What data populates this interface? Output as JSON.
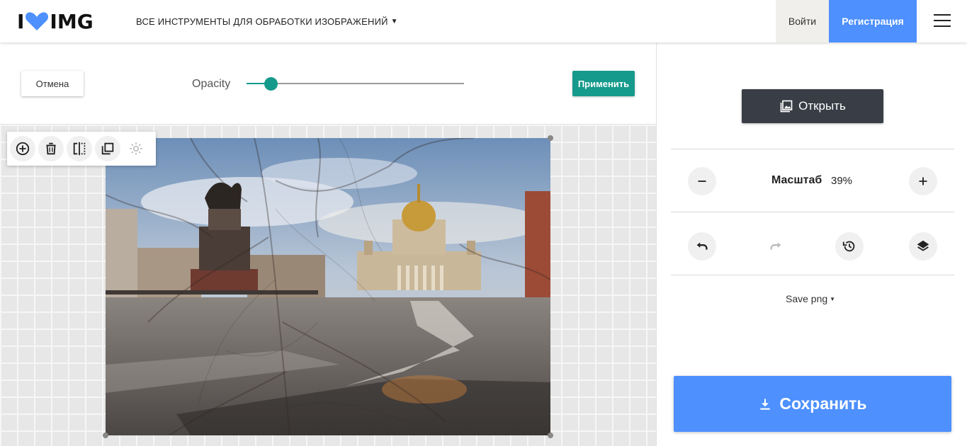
{
  "header": {
    "logo_left": "I",
    "logo_right": "IMG",
    "tools_menu": "ВСЕ ИНСТРУМЕНТЫ ДЛЯ ОБРАБОТКИ ИЗОБРАЖЕНИЙ",
    "login": "Войти",
    "register": "Регистрация"
  },
  "toolbar": {
    "cancel": "Отмена",
    "opacity_label": "Opacity",
    "opacity_fraction": 0.11,
    "apply": "Применить"
  },
  "canvas": {
    "mini_tools": [
      "add-layer-icon",
      "trash-icon",
      "flip-icon",
      "duplicate-icon",
      "settings-icon"
    ]
  },
  "panel": {
    "open": "Открыть",
    "zoom_label": "Масштаб",
    "zoom_value": "39%",
    "save_format": "Save png",
    "save": "Сохранить"
  },
  "colors": {
    "accent_teal": "#169a8c",
    "primary_blue": "#4d90fe",
    "dark_button": "#393e46"
  }
}
